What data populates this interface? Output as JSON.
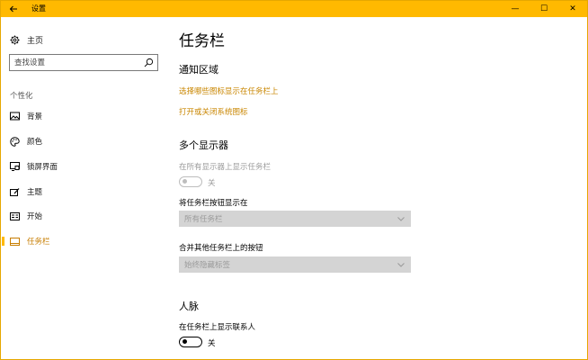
{
  "window": {
    "title": "设置",
    "controls": {
      "minimize": "—",
      "maximize": "☐",
      "close": "✕"
    }
  },
  "sidebar": {
    "home_label": "主页",
    "search_placeholder": "查找设置",
    "group_label": "个性化",
    "items": [
      {
        "label": "背景",
        "icon": "image-icon"
      },
      {
        "label": "颜色",
        "icon": "palette-icon"
      },
      {
        "label": "锁屏界面",
        "icon": "lock-screen-icon"
      },
      {
        "label": "主题",
        "icon": "theme-icon"
      },
      {
        "label": "开始",
        "icon": "start-icon"
      },
      {
        "label": "任务栏",
        "icon": "taskbar-icon",
        "active": true
      }
    ]
  },
  "main": {
    "title": "任务栏",
    "notification_area": {
      "heading": "通知区域",
      "link1": "选择哪些图标显示在任务栏上",
      "link2": "打开或关闭系统图标"
    },
    "multiple_displays": {
      "heading": "多个显示器",
      "show_all_label": "在所有显示器上显示任务栏",
      "show_all_state": "关",
      "buttons_label": "将任务栏按钮显示在",
      "buttons_value": "所有任务栏",
      "combine_label": "合并其他任务栏上的按钮",
      "combine_value": "始终隐藏标签"
    },
    "people": {
      "heading": "人脉",
      "contacts_label": "在任务栏上显示联系人",
      "contacts_state": "关"
    }
  },
  "colors": {
    "accent": "#ffb900",
    "link": "#c98600"
  }
}
